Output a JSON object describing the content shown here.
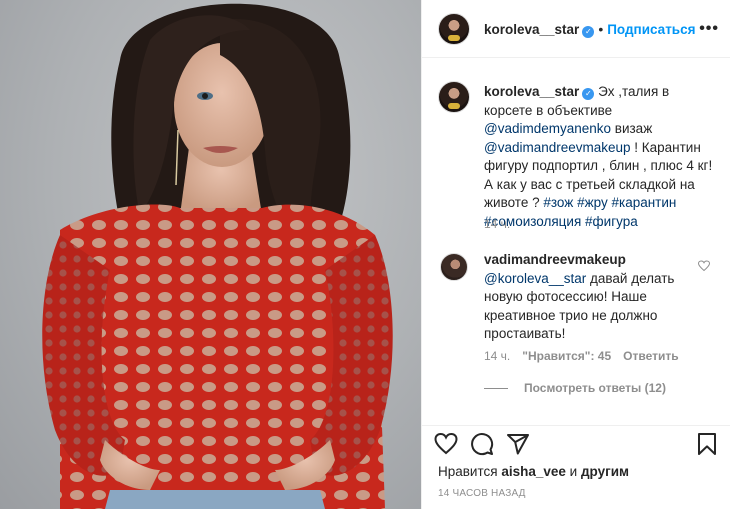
{
  "post": {
    "author": "koroleva__star",
    "verified_mark": "✓",
    "dot": "•",
    "follow_label": "Подписаться",
    "more_label": "•••"
  },
  "caption": {
    "author": "koroleva__star",
    "text_1": " Эх ,талия в корсете в объективе ",
    "mention_1": "@vadimdemyanenko",
    "text_2": " визаж ",
    "mention_2": "@vadimandreevmakeup",
    "text_3": " ! Карантин фигуру подпортил , блин , плюс 4 кг! А как у вас с третьей складкой на животе ? ",
    "tag_1": "#зож",
    "tag_2": "#жру",
    "tag_3": "#карантин",
    "tag_4": "#сомоизоляция",
    "tag_5": "#фигура",
    "time": "14 ч."
  },
  "comment": {
    "author": "vadimandreevmakeup",
    "mention": "@koroleva__star",
    "text": " давай делать новую фотосессию! Наше креативное трио не должно простаивать!",
    "time": "14 ч.",
    "likes_label": "\"Нравится\": 45",
    "reply_label": "Ответить",
    "view_replies_label": "Посмотреть ответы (12)"
  },
  "actions": {
    "likes_prefix": "Нравится ",
    "likes_user": "aisha_vee",
    "likes_mid": " и ",
    "likes_others": "другим",
    "time_ago": "14 ЧАСОВ НАЗАД"
  },
  "icons": {
    "like": "heart-icon",
    "comment": "comment-icon",
    "share": "share-icon",
    "save": "bookmark-icon",
    "more": "more-options-icon"
  },
  "colors": {
    "accent_blue": "#0095f6",
    "verified_blue": "#3897f0",
    "link": "#00376b",
    "muted": "#8e8e8e",
    "top_red": "#c8281d"
  }
}
